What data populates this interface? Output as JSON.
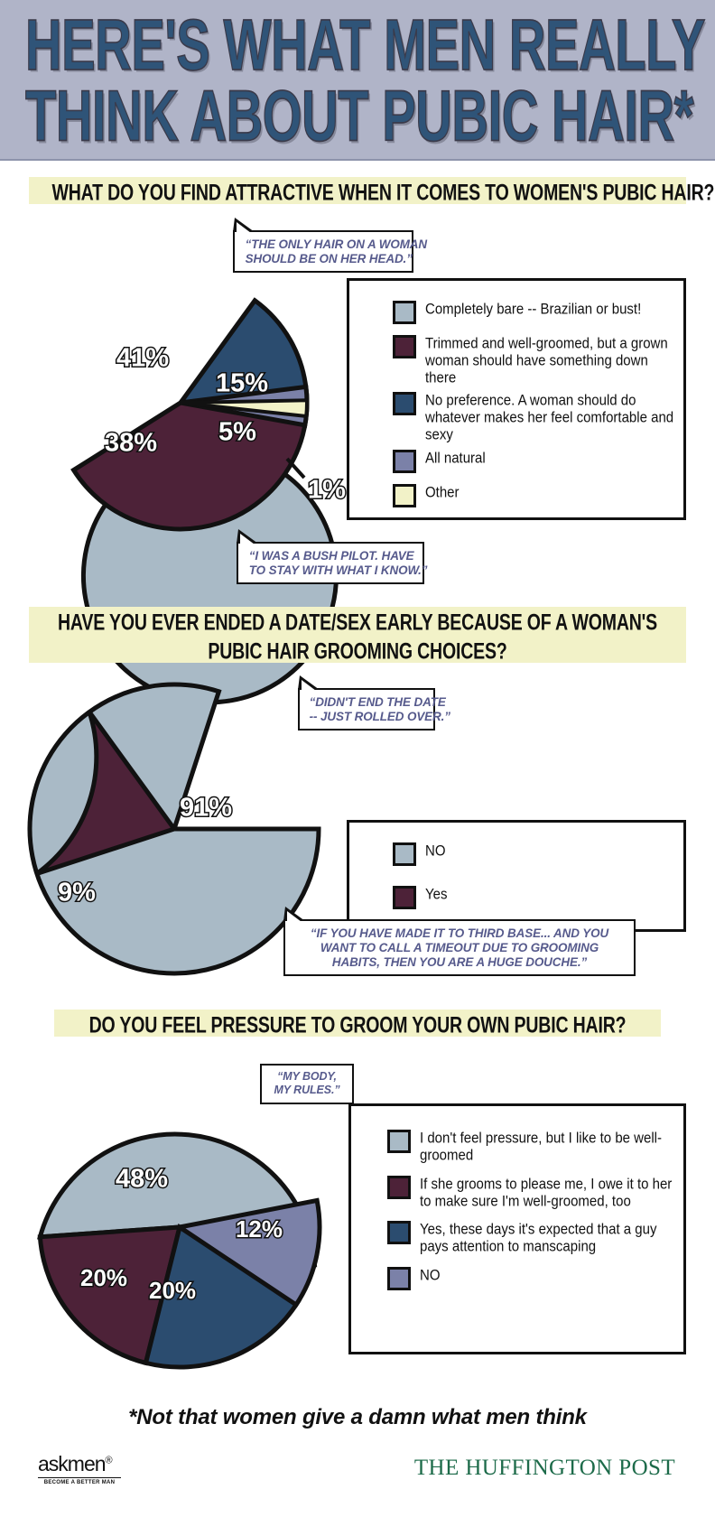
{
  "header": {
    "line1": "Here's What Men Really",
    "line2": "Think About Pubic Hair*",
    "bg_color": "#b0b4c8",
    "text_color": "#2f5478"
  },
  "palette": {
    "light_blue_gray": "#a9bac6",
    "maroon": "#4d2238",
    "navy": "#2b4c6f",
    "periwinkle": "#7b81a8",
    "cream": "#f2f2c8",
    "band_bg": "#f2f2c8",
    "quote_text": "#565a8c",
    "outline": "#111111"
  },
  "sections": [
    {
      "id": "section-1",
      "question": "What do you find attractive when it comes to women's pubic hair?",
      "quotes": [
        {
          "id": "quote-1",
          "lines": [
            "“The only hair on a woman",
            "should be on her head.”"
          ]
        },
        {
          "id": "quote-2",
          "lines": [
            "“I was a bush pilot. Have",
            "to stay with what I know.”"
          ]
        }
      ],
      "legend": [
        {
          "label": "completely bare -- Brazilian or bust!",
          "color": "#a9bac6"
        },
        {
          "label": "Trimmed and well-groomed, but a grown woman should have something down there",
          "color": "#4d2238"
        },
        {
          "label": "No preference. A woman should do whatever makes her feel comfortable and sexy",
          "color": "#2b4c6f"
        },
        {
          "label": "All natural",
          "color": "#7b81a8"
        },
        {
          "label": "other",
          "color": "#f2f2c8"
        }
      ]
    },
    {
      "id": "section-2",
      "question": "Have you ever ended a date/sex early because of a woman's pubic hair grooming choices?",
      "quotes": [
        {
          "id": "quote-3",
          "lines": [
            "“Didn't end the date",
            "-- just rolled over.”"
          ]
        },
        {
          "id": "quote-4",
          "lines": [
            "“If you have made it to third base... and you",
            "want to call a timeout due to grooming",
            "habits, then you are a huge douche.”"
          ]
        }
      ],
      "legend": [
        {
          "label": "NO",
          "color": "#a9bac6"
        },
        {
          "label": "Yes",
          "color": "#4d2238"
        }
      ]
    },
    {
      "id": "section-3",
      "question": "Do you feel pressure to groom your own pubic hair?",
      "quotes": [
        {
          "id": "quote-5",
          "lines": [
            "“My body,",
            "my rules.”"
          ]
        }
      ],
      "legend": [
        {
          "label": "I don't feel pressure, but I like to be well-groomed",
          "color": "#a9bac6"
        },
        {
          "label": "If she grooms to please me, I owe it to her to make sure I'm well-groomed, too",
          "color": "#4d2238"
        },
        {
          "label": "Yes, these days it's expected that a guy pays attention to manscaping",
          "color": "#2b4c6f"
        },
        {
          "label": "NO",
          "color": "#7b81a8"
        }
      ]
    }
  ],
  "chart_data": [
    {
      "type": "pie",
      "title": "What do you find attractive when it comes to women's pubic hair?",
      "categories": [
        "completely bare -- Brazilian or bust!",
        "Trimmed and well-groomed, but a grown woman should have something down there",
        "No preference. A woman should do whatever makes her feel comfortable and sexy",
        "All natural",
        "other"
      ],
      "values": [
        41,
        38,
        15,
        5,
        1
      ],
      "labels": [
        "41%",
        "38%",
        "15%",
        "5%",
        "1%"
      ],
      "colors": [
        "#a9bac6",
        "#4d2238",
        "#2b4c6f",
        "#7b81a8",
        "#f2f2c8"
      ],
      "unit": "percent",
      "legend_position": "right"
    },
    {
      "type": "pie",
      "title": "Have you ever ended a date/sex early because of a woman's pubic hair grooming choices?",
      "categories": [
        "NO",
        "Yes"
      ],
      "values": [
        91,
        9
      ],
      "labels": [
        "91%",
        "9%"
      ],
      "colors": [
        "#a9bac6",
        "#4d2238"
      ],
      "unit": "percent",
      "legend_position": "right"
    },
    {
      "type": "pie",
      "title": "Do you feel pressure to groom your own pubic hair?",
      "categories": [
        "I don't feel pressure, but I like to be well-groomed",
        "If she grooms to please me, I owe it to her to make sure I'm well-groomed, too",
        "Yes, these days it's expected that a guy pays attention to manscaping",
        "NO"
      ],
      "values": [
        48,
        20,
        20,
        12
      ],
      "labels": [
        "48%",
        "20%",
        "20%",
        "12%"
      ],
      "colors": [
        "#a9bac6",
        "#4d2238",
        "#2b4c6f",
        "#7b81a8"
      ],
      "unit": "percent",
      "legend_position": "right"
    }
  ],
  "pie_labels": {
    "p1a": "41%",
    "p1b": "38%",
    "p1c": "15%",
    "p1d": "5%",
    "p1e": "1%",
    "p2a": "91%",
    "p2b": "9%",
    "p3a": "48%",
    "p3b": "20%",
    "p3c": "20%",
    "p3d": "12%"
  },
  "footer": {
    "footnote": "*Not that women give a damn what men think",
    "askmen_name": "askmen",
    "askmen_reg": "®",
    "askmen_tagline": "BECOME A BETTER MAN",
    "huffpost": "THE HUFFINGTON POST",
    "huffpost_color": "#1d6b4a"
  }
}
